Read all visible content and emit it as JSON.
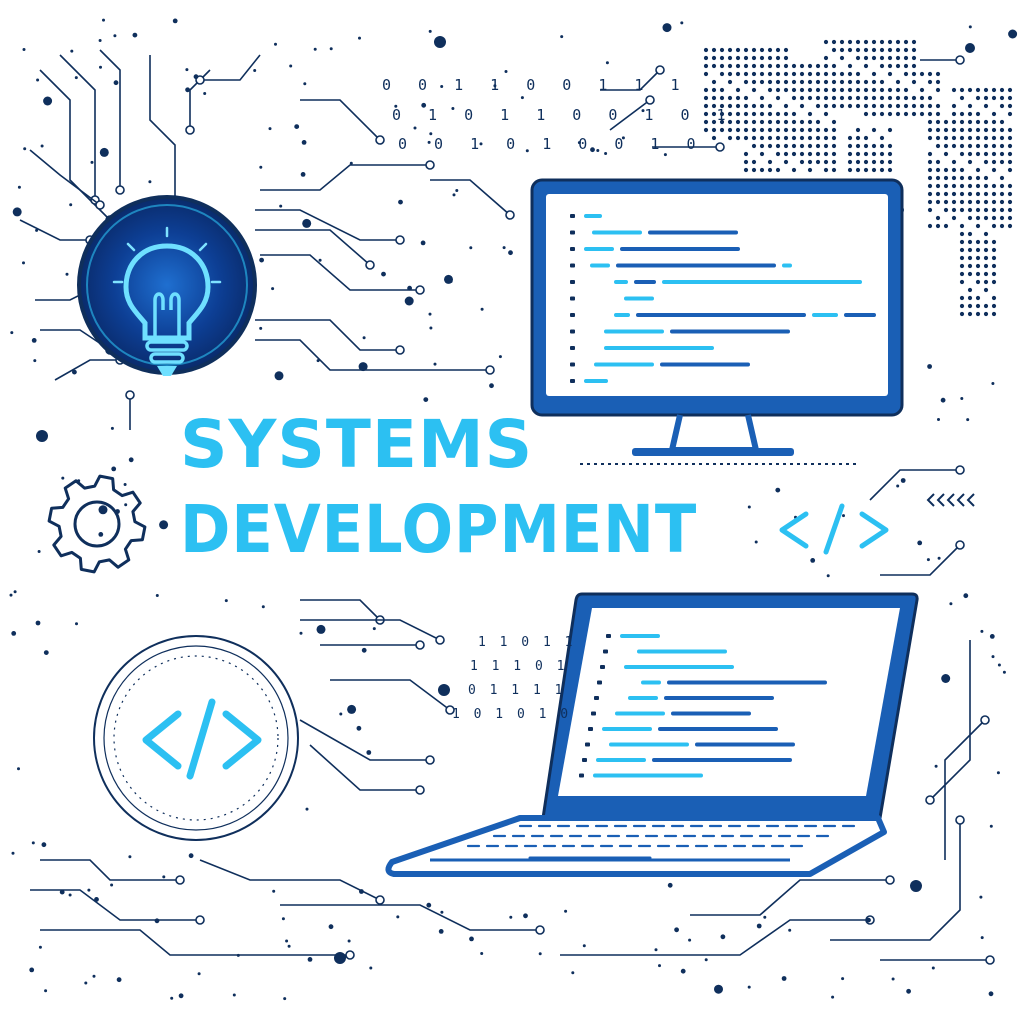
{
  "title": {
    "line1": "SYSTEMS",
    "line2": "DEVELOPMENT"
  },
  "binary_top": [
    "0 0 1 1 0 0 1 1 1",
    "0 1 0 1 1 0 0 1 0 1",
    "0 0 1 0 1 0 0 1 0"
  ],
  "binary_mid": [
    "1 1 0 1 1",
    "1 1 1 0 1",
    "0 1 1 1 1",
    "1 0 1 0 1 0"
  ],
  "icons": {
    "bulb": "lightbulb-icon",
    "gear": "gear-icon",
    "code": "code-brackets-icon",
    "monitor": "monitor-icon",
    "laptop": "laptop-icon",
    "map": "world-map-icon"
  },
  "colors": {
    "navy": "#0f2f5c",
    "blue": "#1f7fd6",
    "cyan": "#2cc0f2",
    "glow": "#1a5fb5",
    "screen": "#ffffff",
    "background": "#ffffff"
  }
}
